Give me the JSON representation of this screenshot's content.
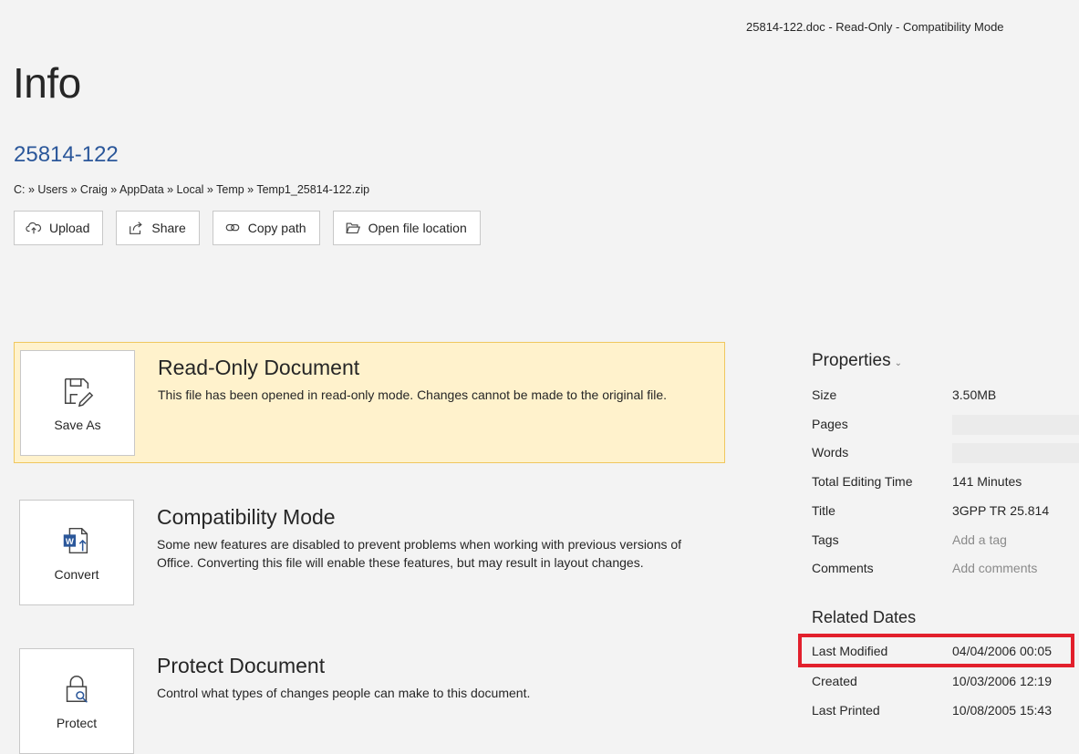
{
  "window": {
    "title": "25814-122.doc  -  Read-Only  -  Compatibility Mode"
  },
  "page": {
    "title": "Info"
  },
  "document": {
    "name": "25814-122",
    "path": "C: » Users » Craig » AppData » Local » Temp » Temp1_25814-122.zip"
  },
  "actions": {
    "upload": "Upload",
    "share": "Share",
    "copy_path": "Copy path",
    "open_location": "Open file location"
  },
  "sections": {
    "readonly": {
      "tile_label": "Save As",
      "heading": "Read-Only Document",
      "text": "This file has been opened in read-only mode. Changes cannot be made to the original file."
    },
    "compat": {
      "tile_label": "Convert",
      "heading": "Compatibility Mode",
      "text": "Some new features are disabled to prevent problems when working with previous versions of Office. Converting this file will enable these features, but may result in layout changes."
    },
    "protect": {
      "tile_label": "Protect",
      "heading": "Protect Document",
      "text": "Control what types of changes people can make to this document."
    }
  },
  "properties": {
    "heading": "Properties",
    "size": {
      "label": "Size",
      "value": "3.50MB"
    },
    "pages": {
      "label": "Pages"
    },
    "words": {
      "label": "Words"
    },
    "editing_time": {
      "label": "Total Editing Time",
      "value": "141 Minutes"
    },
    "title": {
      "label": "Title",
      "value": "3GPP TR 25.814"
    },
    "tags": {
      "label": "Tags",
      "value": "Add a tag"
    },
    "comments": {
      "label": "Comments",
      "value": "Add comments"
    }
  },
  "related_dates": {
    "heading": "Related Dates",
    "last_modified": {
      "label": "Last Modified",
      "value": "04/04/2006 00:05"
    },
    "created": {
      "label": "Created",
      "value": "10/03/2006 12:19"
    },
    "last_printed": {
      "label": "Last Printed",
      "value": "10/08/2005 15:43"
    }
  },
  "colors": {
    "accent": "#2b579a",
    "warning_bg": "#fff2cc",
    "highlight": "#e2202c"
  }
}
